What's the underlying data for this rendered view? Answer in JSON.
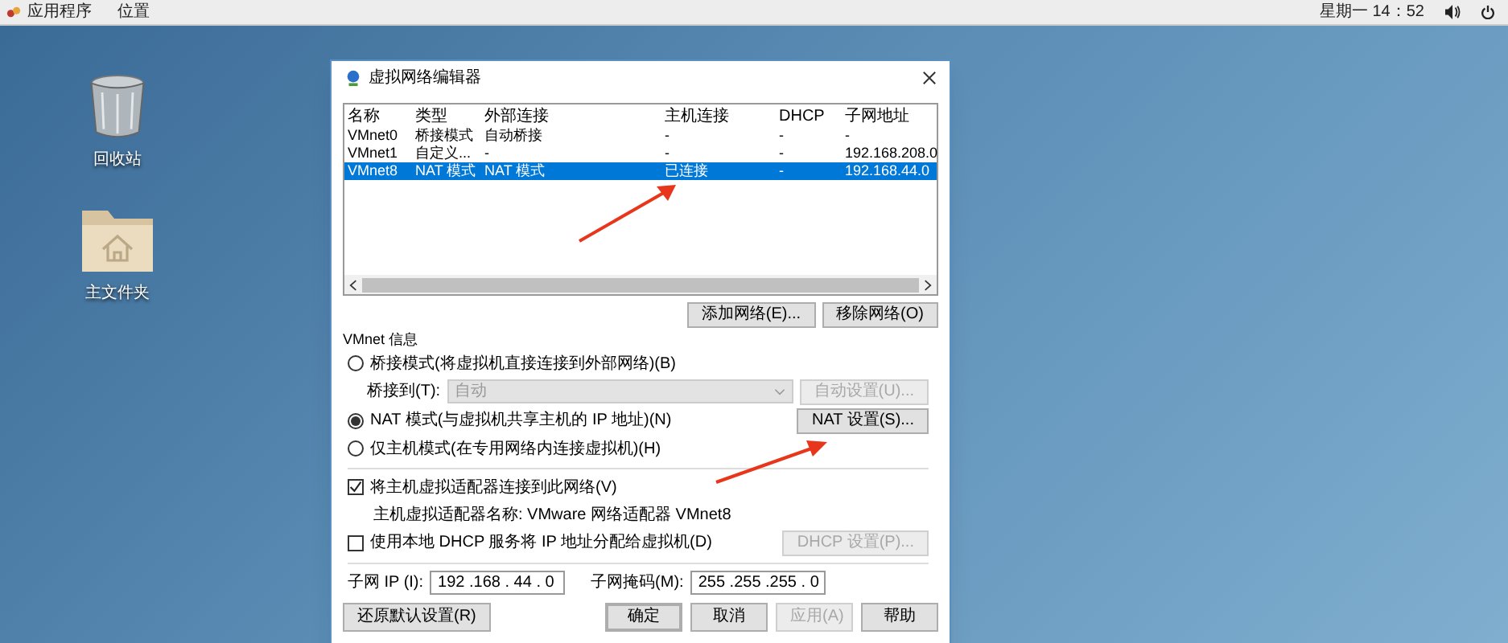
{
  "top_bar": {
    "menus": [
      "应用程序",
      "位置"
    ],
    "clock": "星期一 14：52"
  },
  "desktop_icons": [
    {
      "kind": "trash",
      "label": "回收站"
    },
    {
      "kind": "home-folder",
      "label": "主文件夹"
    }
  ],
  "dialog": {
    "title": "虚拟网络编辑器",
    "table": {
      "columns": [
        "名称",
        "类型",
        "外部连接",
        "主机连接",
        "DHCP",
        "子网地址"
      ],
      "rows": [
        {
          "cells": [
            "VMnet0",
            "桥接模式",
            "自动桥接",
            "-",
            "-",
            "-"
          ],
          "selected": false
        },
        {
          "cells": [
            "VMnet1",
            "自定义...",
            "-",
            "-",
            "-",
            "192.168.208.0"
          ],
          "selected": false
        },
        {
          "cells": [
            "VMnet8",
            "NAT 模式",
            "NAT 模式",
            "已连接",
            "-",
            "192.168.44.0"
          ],
          "selected": true
        }
      ]
    },
    "list_buttons": [
      "添加网络(E)...",
      "移除网络(O)"
    ],
    "info": {
      "title": "VMnet 信息",
      "modes": [
        {
          "label": "桥接模式(将虚拟机直接连接到外部网络)(B)",
          "selected": false
        },
        {
          "label": "NAT 模式(与虚拟机共享主机的 IP 地址)(N)",
          "selected": true
        },
        {
          "label": "仅主机模式(在专用网络内连接虚拟机)(H)",
          "selected": false
        }
      ],
      "bridge_to": {
        "label": "桥接到(T):",
        "value": "自动",
        "disabled": true
      },
      "auto_settings": {
        "label": "自动设置(U)...",
        "disabled": true
      },
      "nat_settings": {
        "label": "NAT 设置(S)...",
        "disabled": false
      },
      "connect_adapter": {
        "label": "将主机虚拟适配器连接到此网络(V)",
        "checked": true
      },
      "adapter_name": "主机虚拟适配器名称: VMware 网络适配器 VMnet8",
      "dhcp": {
        "label": "使用本地 DHCP 服务将 IP 地址分配给虚拟机(D)",
        "checked": false
      },
      "dhcp_settings": {
        "label": "DHCP 设置(P)...",
        "disabled": true
      },
      "subnet_ip": {
        "label": "子网 IP (I):",
        "value": "192 .168 . 44 . 0"
      },
      "subnet_mask": {
        "label": "子网掩码(M):",
        "value": "255 .255 .255 . 0"
      }
    },
    "footer_buttons": [
      {
        "label": "还原默认设置(R)",
        "disabled": false,
        "primary": false
      },
      {
        "label": "确定",
        "disabled": false,
        "primary": true
      },
      {
        "label": "取消",
        "disabled": false,
        "primary": false
      },
      {
        "label": "应用(A)",
        "disabled": true,
        "primary": false
      },
      {
        "label": "帮助",
        "disabled": false,
        "primary": false
      }
    ]
  }
}
